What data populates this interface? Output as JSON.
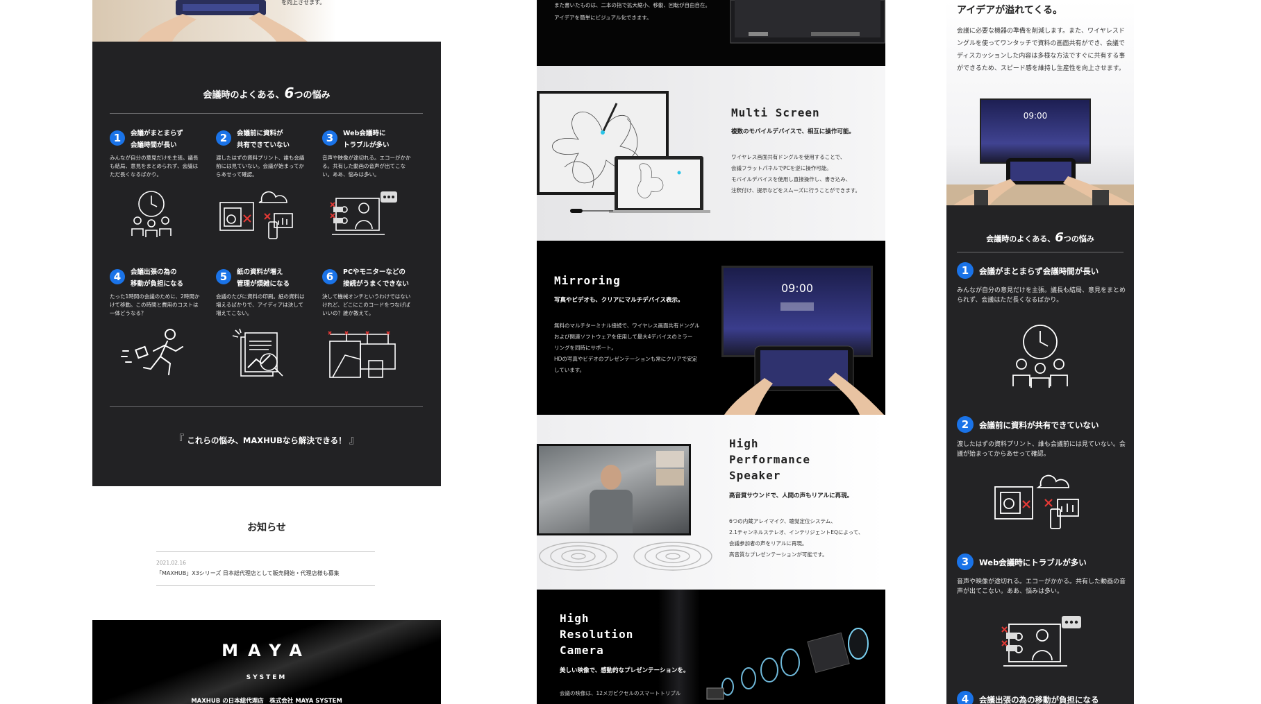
{
  "left_page": {
    "hero_text": "を向上させます。",
    "problems_title_pre": "会議時のよくある、",
    "problems_title_num": "6",
    "problems_title_post": "つの悩み",
    "problems": [
      {
        "num": "1",
        "title": "会議がまとまらず\n会議時間が長い",
        "desc": "みんなが自分の意見だけを主張。議長も結局、意見をまとめられず、会議はただ長くなるばかり。",
        "icon": "meeting-clock-icon"
      },
      {
        "num": "2",
        "title": "会議前に資料が\n共有できていない",
        "desc": "渡したはずの資料プリント、誰も会議前には見ていない。会議が始まってからあせって確認。",
        "icon": "document-sharing-icon"
      },
      {
        "num": "3",
        "title": "Web会議時に\nトラブルが多い",
        "desc": "音声や映像が途切れる。エコーがかかる。共有した動画の音声が出てこない。ああ、悩みは多い。",
        "icon": "web-meeting-trouble-icon"
      },
      {
        "num": "4",
        "title": "会議出張の為の\n移動が負担になる",
        "desc": "たった1時間の会議のために、2時間かけて移動。この時間と費用のコストは一体どうなる？",
        "icon": "running-businessman-icon"
      },
      {
        "num": "5",
        "title": "紙の資料が増え\n管理が煩雑になる",
        "desc": "会議のたびに資料の印刷。紙の資料は増えるばかりで、アイディアは決して増えてこない。",
        "icon": "paper-documents-icon"
      },
      {
        "num": "6",
        "title": "PCやモニターなどの\n接続がうまくできない",
        "desc": "決して機械オンチというわけではないけれど、どこにこのコードをつなげばいいの？誰か教えて。",
        "icon": "cable-connection-icon"
      }
    ],
    "cta": "これらの悩み、MAXHUBなら解決できる！",
    "cta_open": "『",
    "cta_close": "』",
    "news_title": "お知らせ",
    "news": [
      {
        "date": "2021.02.16",
        "text": "「MAXHUB」X3シリーズ 日本総代理店として販売開始・代理店様も募集"
      }
    ],
    "logo_text": "MAYA",
    "logo_sub": "SYSTEM",
    "footer_text": "MAXHUB の日本総代理店　株式会社 MAYA SYSTEM"
  },
  "middle_page": {
    "intro_lines": [
      "また書いたものは、二本の指で拡大縮小、移動、回転が自由自在。",
      "アイデアを簡単にビジュアル化できます。"
    ],
    "sections": [
      {
        "heading": "Multi Screen",
        "subtitle": "複数のモバイルデバイスで、相互に操作可能。",
        "body": [
          "ワイヤレス画面共有ドングルを使用することで、",
          "会議フラットパネルでPCを逆に操作可能。",
          "モバイルデバイスを使用し直接操作し、書き込み、",
          "注釈付け、提示などをスムーズに行うことができます。"
        ]
      },
      {
        "heading": "Mirroring",
        "subtitle": "写真やビデオも、クリアにマルチデバイス表示。",
        "body": [
          "無料のマルチターミナル接続で、ワイヤレス画面共有ドングル",
          "および関連ソフトウェアを使用して最大4デバイスのミラー",
          "リングを同時にサポート。",
          "HDの写真やビデオのプレゼンテーションも常にクリアで安定",
          "しています。"
        ],
        "screen_time": "09:00"
      },
      {
        "heading": "High\nPerformance\nSpeaker",
        "subtitle": "高音質サウンドで、人間の声もリアルに再現。",
        "body": [
          "6つの内蔵アレイマイク、聴覚定位システム、",
          "2.1チャンネルステレオ、インテリジェントEQによって、",
          "会議参加者の声をリアルに再現。",
          "高音質なプレゼンテーションが可能です。"
        ]
      },
      {
        "heading": "High\nResolution\nCamera",
        "subtitle": "美しい映像で、感動的なプレゼンテーションを。",
        "body": [
          "会議の映像は、12メガピクセルのスマートトリプル"
        ]
      }
    ]
  },
  "right_page": {
    "headline": "アイデアが溢れてくる。",
    "intro": "会議に必要な機器の準備を削減します。また、ワイヤレスドングルを使ってワンタッチで資料の画面共有ができ、会議でディスカッションした内容は多様な方法ですぐに共有する事ができるため、スピード感を維持し生産性を向上させます。",
    "screen_time": "09:00",
    "problems_title_pre": "会議時のよくある、",
    "problems_title_num": "6",
    "problems_title_post": "つの悩み",
    "problems": [
      {
        "num": "1",
        "title": "会議がまとまらず会議時間が長い",
        "desc": "みんなが自分の意見だけを主張。議長も結局、意見をまとめられず、会議はただ長くなるばかり。"
      },
      {
        "num": "2",
        "title": "会議前に資料が共有できていない",
        "desc": "渡したはずの資料プリント、誰も会議前には見ていない。会議が始まってからあせって確認。"
      },
      {
        "num": "3",
        "title": "Web会議時にトラブルが多い",
        "desc": "音声や映像が途切れる。エコーがかかる。共有した動画の音声が出てこない。ああ、悩みは多い。"
      },
      {
        "num": "4",
        "title": "会議出張の為の移動が負担になる",
        "desc": ""
      }
    ]
  },
  "colors": {
    "accent_blue": "#1a73e8",
    "dark_bg": "#222224",
    "black_bg": "#000000",
    "error_red": "#e53935"
  }
}
